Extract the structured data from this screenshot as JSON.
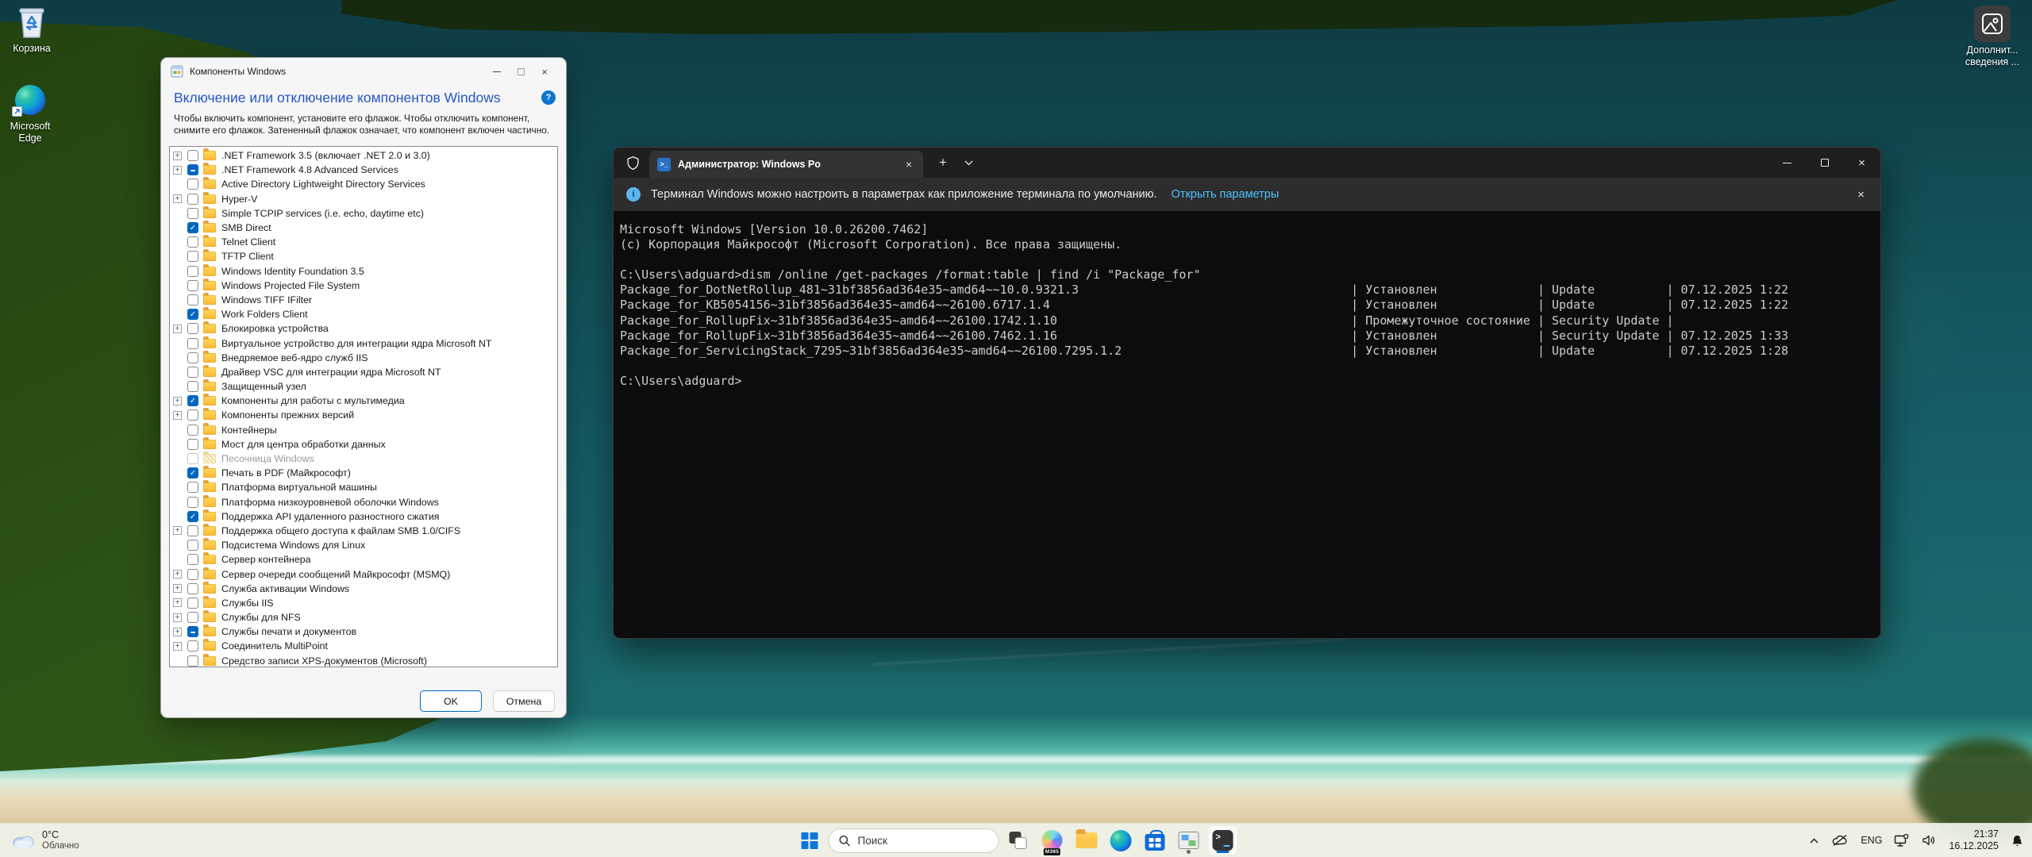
{
  "colors": {
    "accent": "#0067c0",
    "dialog_header_blue": "#2456c5",
    "terminal_link_blue": "#4cc2ff"
  },
  "desktop": {
    "icons": [
      {
        "name": "recycle-bin",
        "label": "Корзина"
      },
      {
        "name": "microsoft-edge",
        "label": "Microsoft Edge"
      },
      {
        "name": "additional-info",
        "label_line1": "Дополнит...",
        "label_line2": "сведения ..."
      }
    ]
  },
  "features_dialog": {
    "title": "Компоненты Windows",
    "minimize": "–",
    "maximize": "□",
    "close": "×",
    "header": "Включение или отключение компонентов Windows",
    "help_glyph": "?",
    "description": "Чтобы включить компонент, установите его флажок. Чтобы отключить компонент, снимите его флажок. Затененный флажок означает, что компонент включен частично.",
    "ok_label": "OK",
    "cancel_label": "Отмена",
    "items": [
      {
        "label": ".NET Framework 3.5 (включает .NET 2.0 и 3.0)",
        "state": "unchecked",
        "expandable": true,
        "disabled": false
      },
      {
        "label": ".NET Framework 4.8 Advanced Services",
        "state": "partial",
        "expandable": true,
        "disabled": false
      },
      {
        "label": "Active Directory Lightweight Directory Services",
        "state": "unchecked",
        "expandable": false,
        "disabled": false
      },
      {
        "label": "Hyper-V",
        "state": "unchecked",
        "expandable": true,
        "disabled": false
      },
      {
        "label": "Simple TCPIP services (i.e. echo, daytime etc)",
        "state": "unchecked",
        "expandable": false,
        "disabled": false
      },
      {
        "label": "SMB Direct",
        "state": "checked",
        "expandable": false,
        "disabled": false
      },
      {
        "label": "Telnet Client",
        "state": "unchecked",
        "expandable": false,
        "disabled": false
      },
      {
        "label": "TFTP Client",
        "state": "unchecked",
        "expandable": false,
        "disabled": false
      },
      {
        "label": "Windows Identity Foundation 3.5",
        "state": "unchecked",
        "expandable": false,
        "disabled": false
      },
      {
        "label": "Windows Projected File System",
        "state": "unchecked",
        "expandable": false,
        "disabled": false
      },
      {
        "label": "Windows TIFF IFilter",
        "state": "unchecked",
        "expandable": false,
        "disabled": false
      },
      {
        "label": "Work Folders Client",
        "state": "checked",
        "expandable": false,
        "disabled": false
      },
      {
        "label": "Блокировка устройства",
        "state": "unchecked",
        "expandable": true,
        "disabled": false
      },
      {
        "label": "Виртуальное устройство для интеграции ядра Microsoft NT",
        "state": "unchecked",
        "expandable": false,
        "disabled": false
      },
      {
        "label": "Внедряемое веб-ядро служб IIS",
        "state": "unchecked",
        "expandable": false,
        "disabled": false
      },
      {
        "label": "Драйвер VSC для интеграции ядра Microsoft NT",
        "state": "unchecked",
        "expandable": false,
        "disabled": false
      },
      {
        "label": "Защищенный узел",
        "state": "unchecked",
        "expandable": false,
        "disabled": false
      },
      {
        "label": "Компоненты для работы с мультимедиа",
        "state": "checked",
        "expandable": true,
        "disabled": false
      },
      {
        "label": "Компоненты прежних версий",
        "state": "unchecked",
        "expandable": true,
        "disabled": false
      },
      {
        "label": "Контейнеры",
        "state": "unchecked",
        "expandable": false,
        "disabled": false
      },
      {
        "label": "Мост для центра обработки данных",
        "state": "unchecked",
        "expandable": false,
        "disabled": false
      },
      {
        "label": "Песочница Windows",
        "state": "unchecked",
        "expandable": false,
        "disabled": true
      },
      {
        "label": "Печать в PDF (Майкрософт)",
        "state": "checked",
        "expandable": false,
        "disabled": false
      },
      {
        "label": "Платформа виртуальной машины",
        "state": "unchecked",
        "expandable": false,
        "disabled": false
      },
      {
        "label": "Платформа низкоуровневой оболочки Windows",
        "state": "unchecked",
        "expandable": false,
        "disabled": false
      },
      {
        "label": "Поддержка API удаленного разностного сжатия",
        "state": "checked",
        "expandable": false,
        "disabled": false
      },
      {
        "label": "Поддержка общего доступа к файлам SMB 1.0/CIFS",
        "state": "unchecked",
        "expandable": true,
        "disabled": false
      },
      {
        "label": "Подсистема Windows для Linux",
        "state": "unchecked",
        "expandable": false,
        "disabled": false
      },
      {
        "label": "Сервер контейнера",
        "state": "unchecked",
        "expandable": false,
        "disabled": false
      },
      {
        "label": "Сервер очереди сообщений Майкрософт (MSMQ)",
        "state": "unchecked",
        "expandable": true,
        "disabled": false
      },
      {
        "label": "Служба активации Windows",
        "state": "unchecked",
        "expandable": true,
        "disabled": false
      },
      {
        "label": "Службы IIS",
        "state": "unchecked",
        "expandable": true,
        "disabled": false
      },
      {
        "label": "Службы для NFS",
        "state": "unchecked",
        "expandable": true,
        "disabled": false
      },
      {
        "label": "Службы печати и документов",
        "state": "partial",
        "expandable": true,
        "disabled": false
      },
      {
        "label": "Соединитель MultiPoint",
        "state": "unchecked",
        "expandable": true,
        "disabled": false
      },
      {
        "label": "Средство записи XPS-документов (Microsoft)",
        "state": "unchecked",
        "expandable": false,
        "disabled": false
      }
    ]
  },
  "terminal": {
    "tab_title": "Администратор: Windows Po",
    "tab_close": "×",
    "new_tab": "+",
    "minimize": "–",
    "maximize": "□",
    "close": "×",
    "banner": {
      "info_glyph": "i",
      "text": "Терминал Windows можно настроить в параметрах как приложение терминала по умолчанию.",
      "link": "Открыть параметры",
      "close": "×"
    },
    "system_lines": [
      "Microsoft Windows [Version 10.0.26200.7462]",
      "(c) Корпорация Майкрософт (Microsoft Corporation). Все права защищены."
    ],
    "prompt": "C:\\Users\\adguard>",
    "command": "dism /online /get-packages /format:table | find /i \"Package_for\"",
    "packages": [
      {
        "name": "Package_for_DotNetRollup_481~31bf3856ad364e35~amd64~~10.0.9321.3",
        "status": "Установлен",
        "type": "Update",
        "date": "07.12.2025 1:22"
      },
      {
        "name": "Package_for_KB5054156~31bf3856ad364e35~amd64~~26100.6717.1.4",
        "status": "Установлен",
        "type": "Update",
        "date": "07.12.2025 1:22"
      },
      {
        "name": "Package_for_RollupFix~31bf3856ad364e35~amd64~~26100.1742.1.10",
        "status": "Промежуточное состояние",
        "type": "Security Update",
        "date": ""
      },
      {
        "name": "Package_for_RollupFix~31bf3856ad364e35~amd64~~26100.7462.1.16",
        "status": "Установлен",
        "type": "Security Update",
        "date": "07.12.2025 1:33"
      },
      {
        "name": "Package_for_ServicingStack_7295~31bf3856ad364e35~amd64~~26100.7295.1.2",
        "status": "Установлен",
        "type": "Update",
        "date": "07.12.2025 1:28"
      }
    ]
  },
  "taskbar": {
    "weather": {
      "temp": "0°C",
      "condition": "Облачно"
    },
    "search_placeholder": "Поиск",
    "copilot_badge": "M365",
    "tray": {
      "language": "ENG",
      "time": "21:37",
      "date": "16.12.2025"
    }
  }
}
